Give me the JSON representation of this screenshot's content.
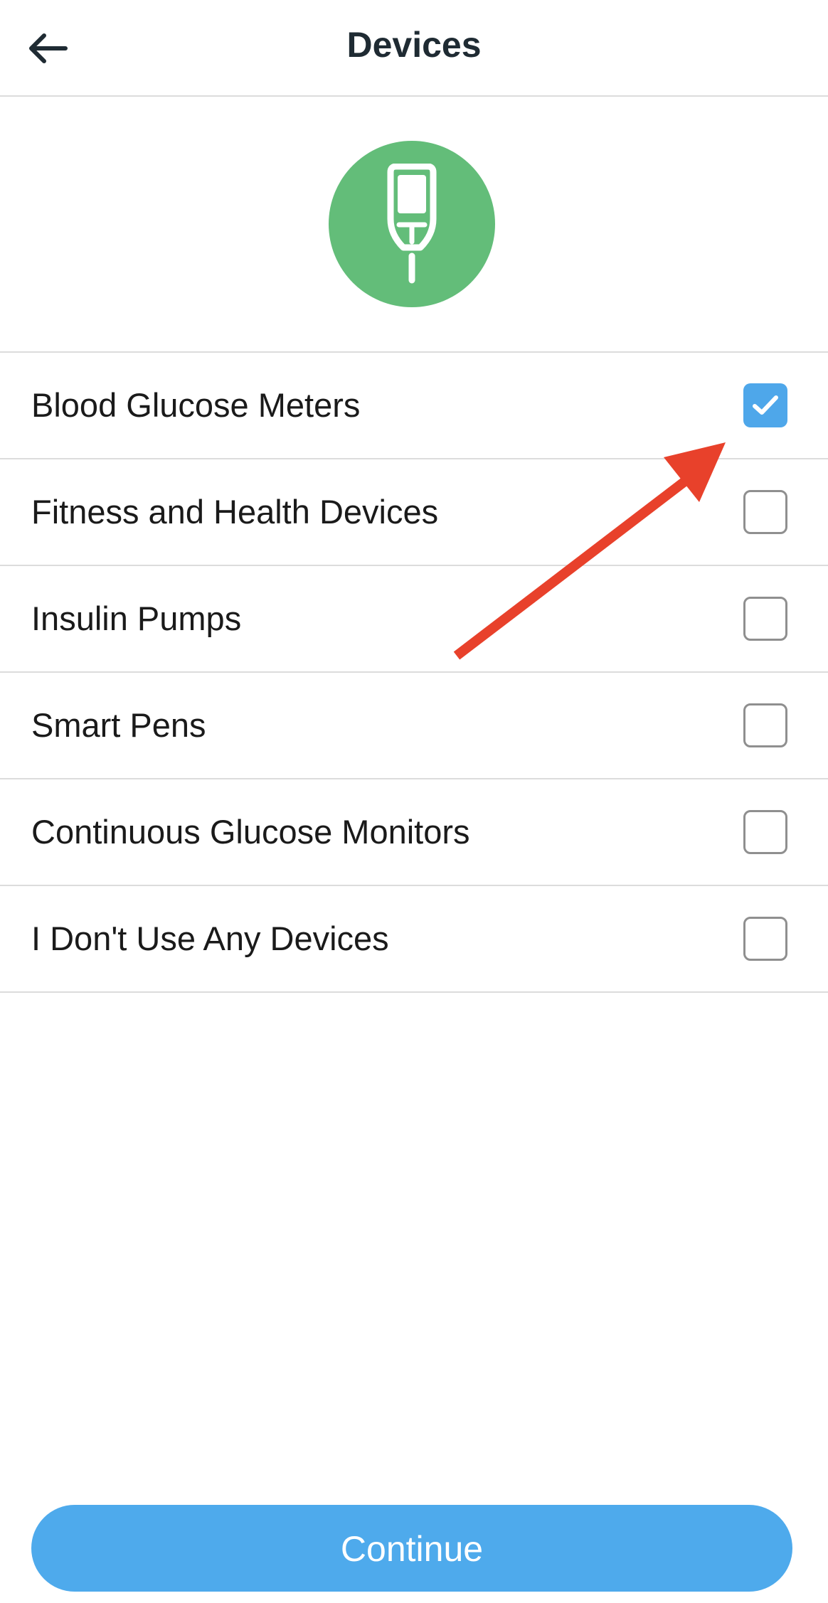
{
  "header": {
    "title": "Devices",
    "back_icon": "arrow-left-icon"
  },
  "hero": {
    "icon": "glucose-meter-icon",
    "color": "#63bd79"
  },
  "devices": [
    {
      "label": "Blood Glucose Meters",
      "checked": true
    },
    {
      "label": "Fitness and Health Devices",
      "checked": false
    },
    {
      "label": "Insulin Pumps",
      "checked": false
    },
    {
      "label": "Smart Pens",
      "checked": false
    },
    {
      "label": "Continuous Glucose Monitors",
      "checked": false
    },
    {
      "label": "I Don't Use Any Devices",
      "checked": false
    }
  ],
  "annotation": {
    "type": "arrow",
    "color": "#e8412b"
  },
  "footer": {
    "continue_label": "Continue",
    "color": "#4eaaec"
  }
}
